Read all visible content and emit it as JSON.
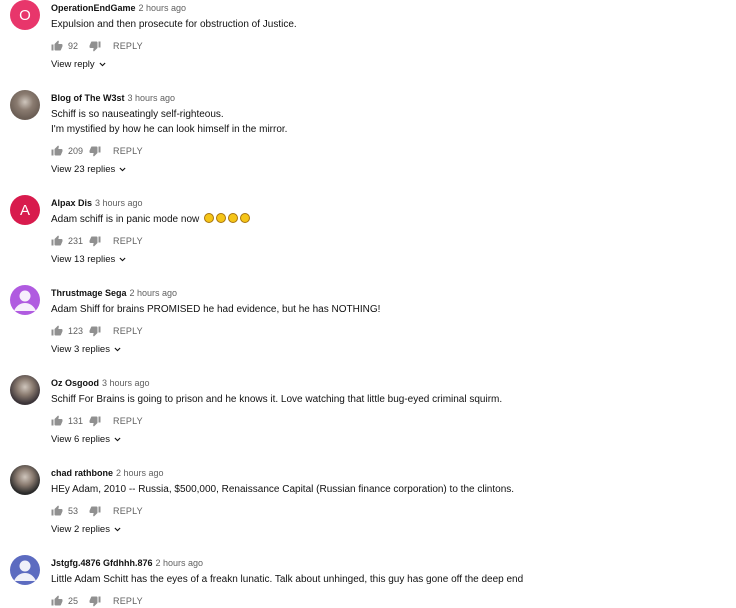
{
  "comments": [
    {
      "author": "OperationEndGame",
      "time": "2 hours ago",
      "lines": [
        "Expulsion and then prosecute for obstruction of Justice."
      ],
      "likes": "92",
      "reply": "REPLY",
      "view_replies": "View reply",
      "avatar": {
        "type": "letter",
        "letter": "O",
        "color": "#e8366b"
      }
    },
    {
      "author": "Blog of The W3st",
      "time": "3 hours ago",
      "lines": [
        "Schiff is so nauseatingly self-righteous.",
        "I'm mystified by how he can look himself in the mirror."
      ],
      "likes": "209",
      "reply": "REPLY",
      "view_replies": "View 23 replies",
      "avatar": {
        "type": "photo",
        "color": "#6b5e55"
      }
    },
    {
      "author": "Alpax Dis",
      "time": "3 hours ago",
      "lines": [
        "Adam schiff is in panic mode now"
      ],
      "emoji_count": 4,
      "likes": "231",
      "reply": "REPLY",
      "view_replies": "View 13 replies",
      "avatar": {
        "type": "letter",
        "letter": "A",
        "color": "#d81b4d"
      }
    },
    {
      "author": "Thrustmage Sega",
      "time": "2 hours ago",
      "lines": [
        "Adam Shiff for brains PROMISED he had evidence, but he has NOTHING!"
      ],
      "likes": "123",
      "reply": "REPLY",
      "view_replies": "View 3 replies",
      "avatar": {
        "type": "default",
        "color": "#b05be0"
      }
    },
    {
      "author": "Oz Osgood",
      "time": "3 hours ago",
      "lines": [
        "Schiff For Brains is going to prison and he knows it.  Love watching that little bug-eyed criminal squirm."
      ],
      "likes": "131",
      "reply": "REPLY",
      "view_replies": "View 6 replies",
      "avatar": {
        "type": "photo",
        "color": "#3b3438"
      }
    },
    {
      "author": "chad rathbone",
      "time": "2 hours ago",
      "lines": [
        "HEy Adam, 2010 -- Russia, $500,000, Renaissance Capital (Russian finance corporation) to the clintons."
      ],
      "likes": "53",
      "reply": "REPLY",
      "view_replies": "View 2 replies",
      "avatar": {
        "type": "photo",
        "color": "#2a2a2a"
      }
    },
    {
      "author": "Jstgfg.4876 Gfdhhh.876",
      "time": "2 hours ago",
      "lines": [
        "Little Adam Schitt has the eyes of a freakn lunatic. Talk about unhinged, this guy has gone off the deep end"
      ],
      "likes": "25",
      "reply": "REPLY",
      "view_replies": "",
      "avatar": {
        "type": "default",
        "color": "#5c6bc0"
      }
    }
  ]
}
